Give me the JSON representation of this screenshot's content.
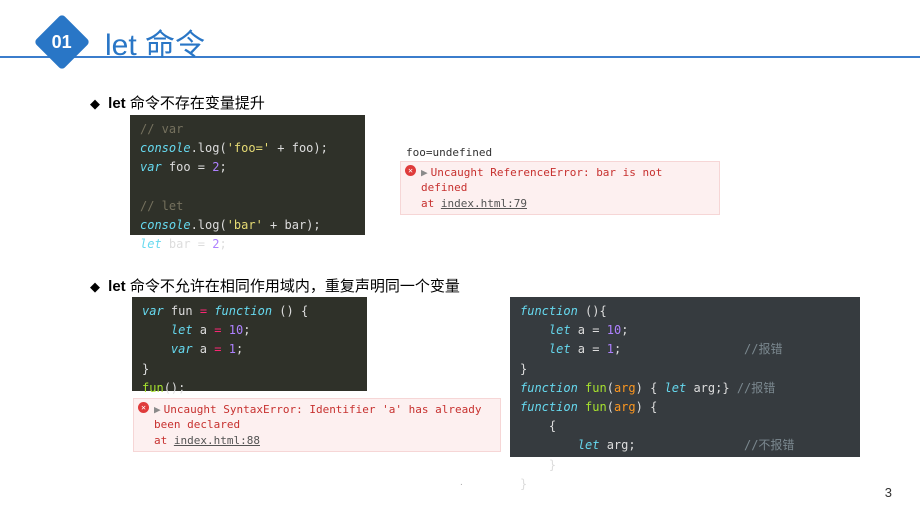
{
  "badge": "01",
  "title": "let 命令",
  "bullet1_bold": "let",
  "bullet1_rest": " 命令不存在变量提升",
  "bullet2_bold": "let",
  "bullet2_rest": " 命令不允许在相同作用域内，重复声明同一个变量",
  "code1": {
    "c1": "// var",
    "l2_a": "console",
    "l2_b": ".log(",
    "l2_c": "'foo='",
    "l2_d": " + foo);",
    "l3_a": "var",
    "l3_b": " foo = ",
    "l3_c": "2",
    "l3_d": ";",
    "c2": "// let",
    "l5_a": "console",
    "l5_b": ".log(",
    "l5_c": "'bar'",
    "l5_d": " + bar);",
    "l6_a": "let",
    "l6_b": " bar = ",
    "l6_c": "2",
    "l6_d": ";"
  },
  "console1": {
    "log": "foo=undefined",
    "err_main": "Uncaught ReferenceError: bar is not defined",
    "err_at": "    at ",
    "err_link": "index.html:79"
  },
  "code2": {
    "l1_a": "var",
    "l1_b": " fun ",
    "l1_c": "=",
    "l1_d": " function",
    "l1_e": " () {",
    "l2_a": "    let",
    "l2_b": " a ",
    "l2_c": "=",
    "l2_d": " 10",
    "l2_e": ";",
    "l3_a": "    var",
    "l3_b": " a ",
    "l3_c": "=",
    "l3_d": " 1",
    "l3_e": ";",
    "l4": "}",
    "l5_a": "fun",
    "l5_b": "();"
  },
  "console2": {
    "err_main": "Uncaught SyntaxError: Identifier 'a' has already been declared",
    "err_at": "    at ",
    "err_link": "index.html:88"
  },
  "code3": {
    "l1_a": "function",
    "l1_b": " (){",
    "l2_a": "    let",
    "l2_b": " a ",
    "l2_c": "=",
    "l2_d": " 10",
    "l2_e": ";",
    "l3_a": "    let",
    "l3_b": " a ",
    "l3_c": "=",
    "l3_d": " 1",
    "l3_e": ";",
    "l3_cmt": "//报错",
    "l4": "}",
    "l5_a": "function",
    "l5_b": " fun",
    "l5_c": "(",
    "l5_d": "arg",
    "l5_e": ") { ",
    "l5_f": "let",
    "l5_g": " arg;}",
    "l5_cmt": "//报错",
    "l6_a": "function",
    "l6_b": " fun",
    "l6_c": "(",
    "l6_d": "arg",
    "l6_e": ") {",
    "l7": "    {",
    "l8_a": "        let",
    "l8_b": " arg;",
    "l8_cmt": "//不报错",
    "l9": "    }",
    "l10": "}"
  },
  "page_number": "3"
}
